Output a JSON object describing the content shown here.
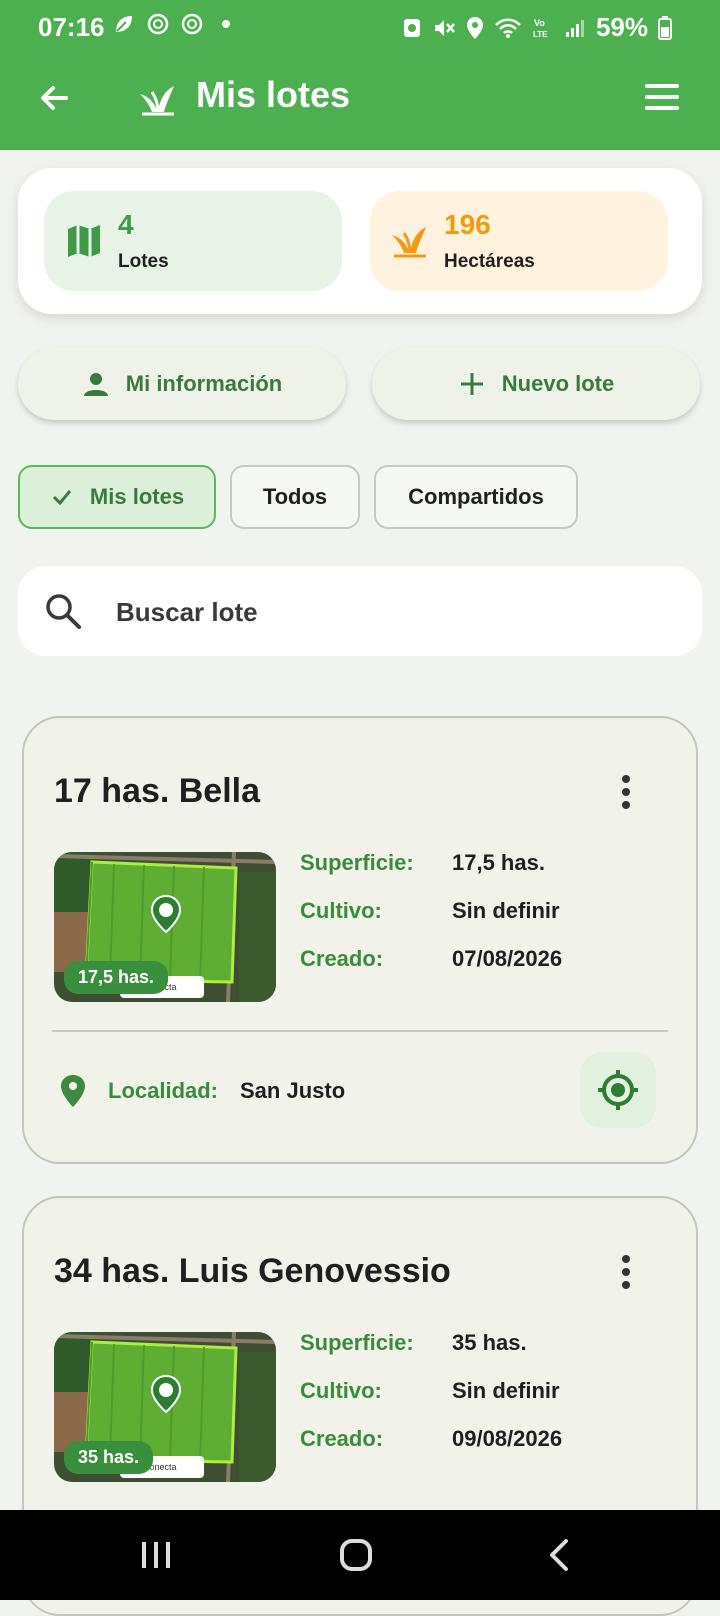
{
  "status_bar": {
    "time": "07:16",
    "left_icons": [
      "leaf-icon",
      "openai-icon",
      "openai-icon",
      "dot-icon"
    ],
    "right_icons": [
      "recycle-icon",
      "mute-icon",
      "location-icon",
      "wifi-icon",
      "volte-icon",
      "signal-icon"
    ],
    "battery": "59%"
  },
  "app_bar": {
    "title": "Mis lotes",
    "back_icon": "arrow-back-icon",
    "logo_icon": "sprout-logo-icon",
    "menu_icon": "hamburger-menu-icon",
    "color": "#4caf50"
  },
  "summary": {
    "lotes": {
      "value": "4",
      "label": "Lotes",
      "icon": "map-icon",
      "color": "#3f9a47"
    },
    "hectareas": {
      "value": "196",
      "label": "Hectáreas",
      "icon": "sprout-icon",
      "color": "#f29b11"
    }
  },
  "actions": {
    "mi_info": {
      "label": "Mi información",
      "icon": "person-icon"
    },
    "nuevo_lote": {
      "label": "Nuevo lote",
      "icon": "plus-icon"
    }
  },
  "filters": [
    {
      "label": "Mis lotes",
      "selected": true
    },
    {
      "label": "Todos",
      "selected": false
    },
    {
      "label": "Compartidos",
      "selected": false
    }
  ],
  "search": {
    "placeholder": "Buscar lote",
    "value": ""
  },
  "lotes": [
    {
      "name": "17 has. Bella",
      "thumb_badge": "17,5 has.",
      "thumb_logo": "AgroConecta",
      "fields": [
        {
          "key": "Superficie:",
          "value": "17,5 has."
        },
        {
          "key": "Cultivo:",
          "value": "Sin definir"
        },
        {
          "key": "Creado:",
          "value": "07/08/2026"
        }
      ],
      "localidad_label": "Localidad:",
      "localidad": "San Justo"
    },
    {
      "name": "34 has. Luis Genovessio",
      "thumb_badge": "35 has.",
      "thumb_logo": "AgroConecta",
      "fields": [
        {
          "key": "Superficie:",
          "value": "35 has."
        },
        {
          "key": "Cultivo:",
          "value": "Sin definir"
        },
        {
          "key": "Creado:",
          "value": "09/08/2026"
        }
      ]
    }
  ],
  "nav_bar": {
    "recents_icon": "recents-icon",
    "home_icon": "home-icon",
    "back_icon": "nav-back-icon"
  }
}
